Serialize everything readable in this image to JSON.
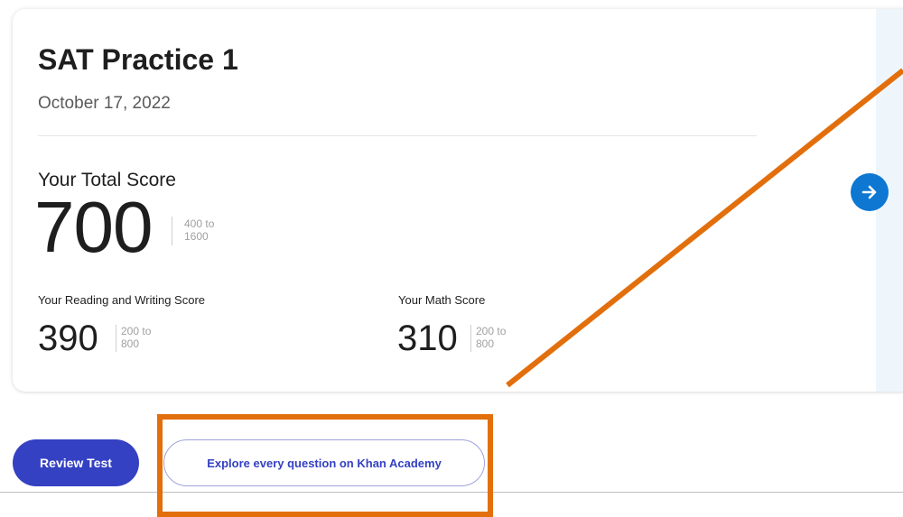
{
  "card": {
    "title": "SAT Practice 1",
    "date": "October 17, 2022"
  },
  "total": {
    "label": "Your Total Score",
    "score": "700",
    "range_line1": "400 to",
    "range_line2": "1600"
  },
  "reading_writing": {
    "label": "Your Reading and Writing Score",
    "score": "390",
    "range_line1": "200 to",
    "range_line2": "800"
  },
  "math": {
    "label": "Your Math Score",
    "score": "310",
    "range_line1": "200 to",
    "range_line2": "800"
  },
  "actions": {
    "review_label": "Review Test",
    "explore_label": "Explore every question on Khan Academy"
  },
  "icons": {
    "next": "arrow-right-icon"
  },
  "colors": {
    "primary": "#3441c2",
    "next_button": "#0d77d2",
    "annotation": "#e26f0c"
  }
}
